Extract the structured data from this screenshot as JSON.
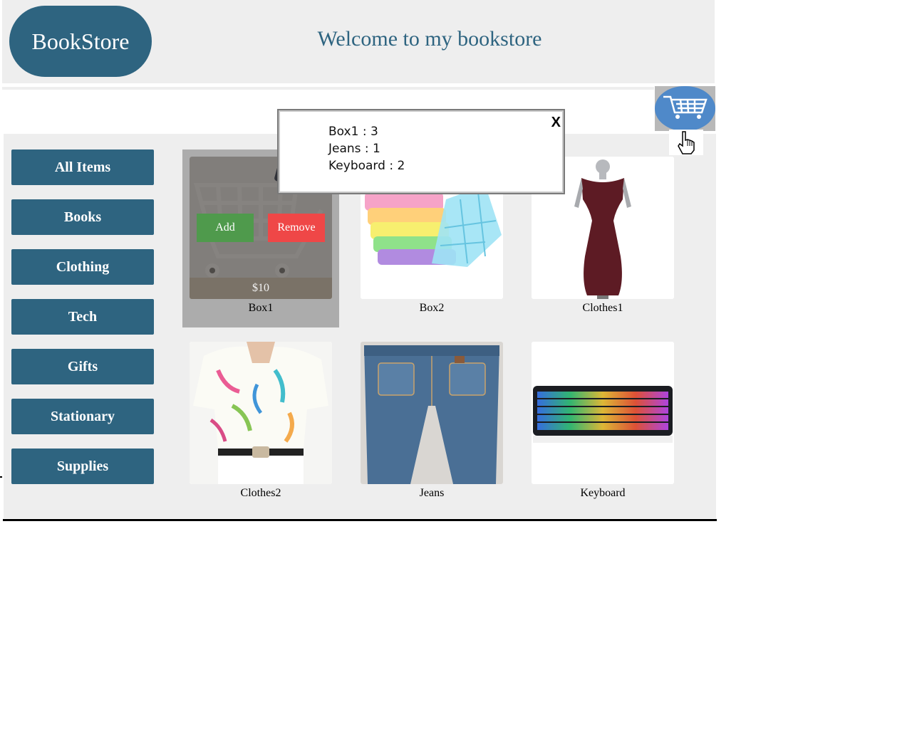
{
  "header": {
    "logo": "BookStore",
    "welcome": "Welcome to my bookstore"
  },
  "sidebar": {
    "items": [
      {
        "label": "All Items"
      },
      {
        "label": "Books"
      },
      {
        "label": "Clothing"
      },
      {
        "label": "Tech"
      },
      {
        "label": "Gifts"
      },
      {
        "label": "Stationary"
      },
      {
        "label": "Supplies"
      }
    ]
  },
  "products": [
    {
      "name": "Box1",
      "price": "$10",
      "add_label": "Add",
      "remove_label": "Remove"
    },
    {
      "name": "Box2"
    },
    {
      "name": "Clothes1"
    },
    {
      "name": "Clothes2"
    },
    {
      "name": "Jeans"
    },
    {
      "name": "Keyboard"
    }
  ],
  "cart_popup": {
    "close_label": "X",
    "items": [
      {
        "text": "Box1 : 3"
      },
      {
        "text": "Jeans : 1"
      },
      {
        "text": "Keyboard : 2"
      }
    ]
  },
  "icons": {
    "cart": "shopping-cart-icon",
    "cursor": "hand-pointer-icon"
  },
  "colors": {
    "brand": "#2e6480",
    "cart_button": "#4f89c9",
    "add": "#4f9a4c",
    "remove": "#ef4747",
    "panel": "#eeeeee"
  }
}
